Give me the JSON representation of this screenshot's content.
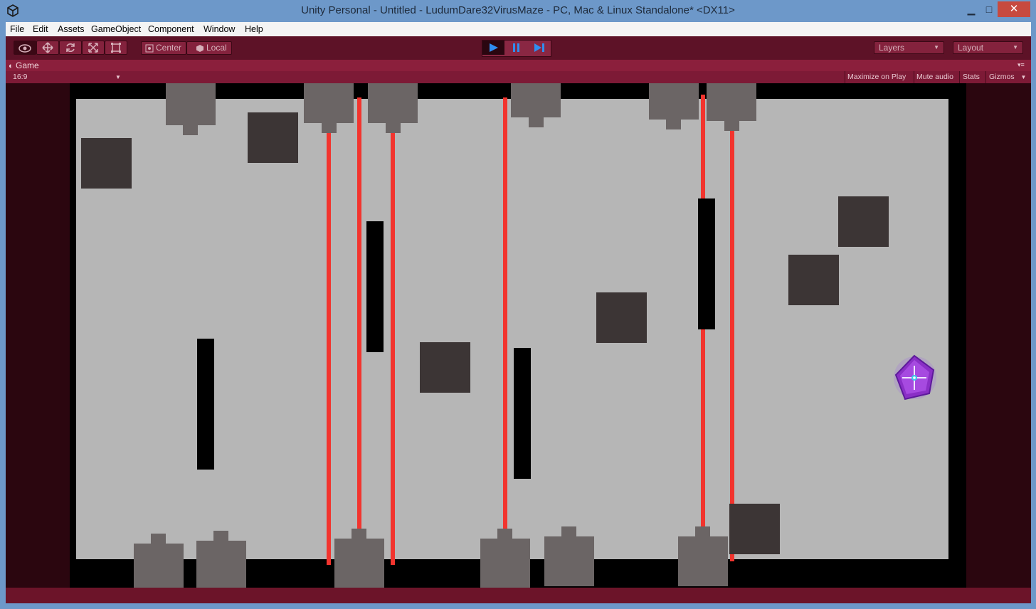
{
  "window": {
    "title": "Unity Personal - Untitled - LudumDare32VirusMaze - PC, Mac & Linux Standalone* <DX11>",
    "minimize_glyph": "▁",
    "maximize_glyph": "□",
    "close_glyph": "✕"
  },
  "menu": [
    "File",
    "Edit",
    "Assets",
    "GameObject",
    "Component",
    "Window",
    "Help"
  ],
  "toolbar": {
    "pivot_label": "Center",
    "space_label": "Local",
    "layers_label": "Layers",
    "layout_label": "Layout"
  },
  "game_tab": {
    "label": "Game",
    "aspect": "16:9",
    "maximize_on_play": "Maximize on Play",
    "mute_audio": "Mute audio",
    "stats": "Stats",
    "gizmos": "Gizmos"
  },
  "colors": {
    "theme": "#5d1227",
    "floor": "#b6b6b6",
    "wall": "#000000",
    "box": "#3c3535",
    "turret": "#6b6565",
    "laser": "#f2342e",
    "player": "#8a2fc6"
  }
}
